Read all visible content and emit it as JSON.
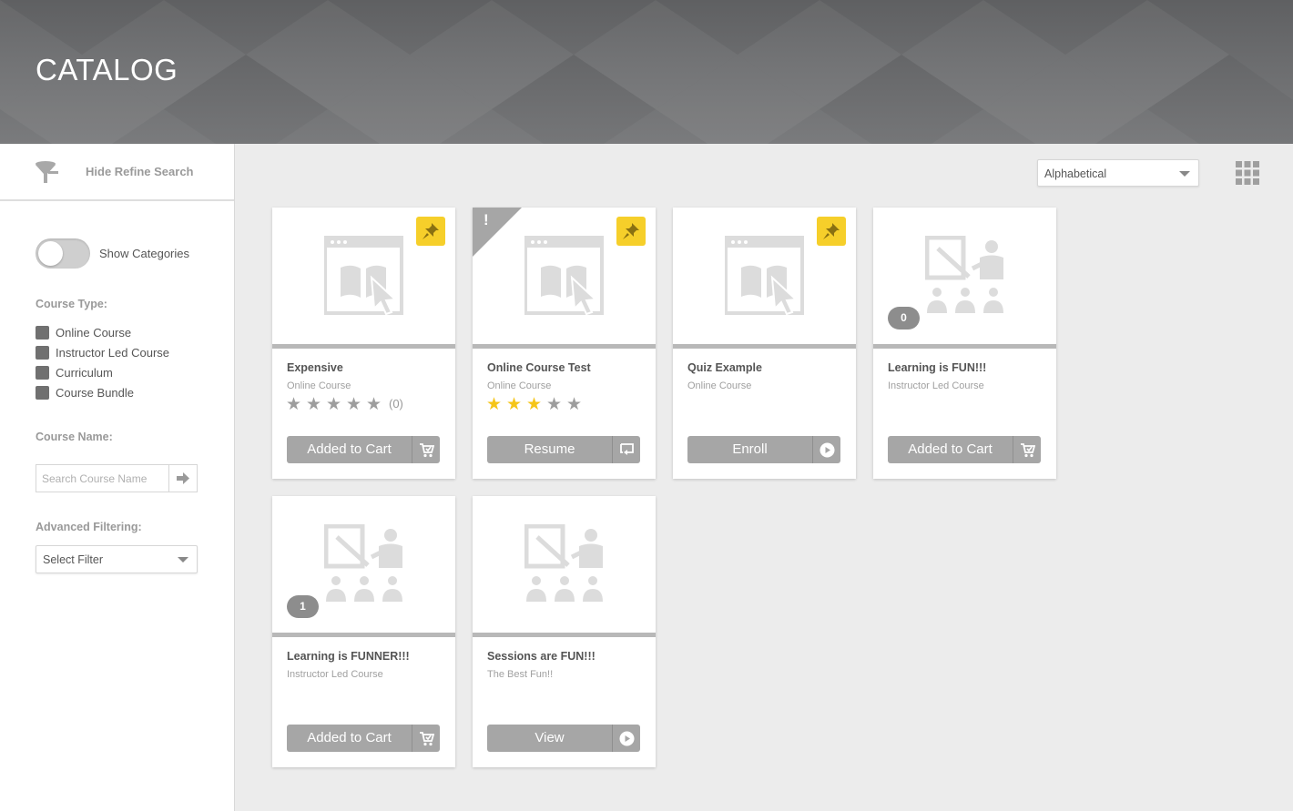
{
  "header": {
    "title": "CATALOG"
  },
  "sidebar": {
    "refine_label": "Hide Refine Search",
    "toggle_label": "Show Categories",
    "toggle_on": false,
    "course_type_label": "Course Type:",
    "course_types": [
      "Online Course",
      "Instructor Led Course",
      "Curriculum",
      "Course Bundle"
    ],
    "course_name_label": "Course Name:",
    "search_placeholder": "Search Course Name",
    "advanced_label": "Advanced Filtering:",
    "filter_value": "Select Filter"
  },
  "toolbar": {
    "sort_value": "Alphabetical"
  },
  "colors": {
    "pin": "#f6cf2a",
    "star_on": "#f5c518",
    "button": "#a6a6a6",
    "header": "#6c6d6f"
  },
  "cards": [
    {
      "title": "Expensive",
      "type": "Online Course",
      "pinned": true,
      "rating": 0,
      "rating_count": "(0)",
      "button": "Added to Cart",
      "button_icon": "cart-icon"
    },
    {
      "title": "Online Course Test",
      "type": "Online Course",
      "pinned": true,
      "flag": "!",
      "rating": 3,
      "button": "Resume",
      "button_icon": "resume-icon"
    },
    {
      "title": "Quiz Example",
      "type": "Online Course",
      "pinned": true,
      "button": "Enroll",
      "button_icon": "play-icon"
    },
    {
      "title": "Learning is FUN!!!",
      "type": "Instructor Led Course",
      "count": "0",
      "button": "Added to Cart",
      "button_icon": "cart-icon"
    },
    {
      "title": "Learning is FUNNER!!!",
      "type": "Instructor Led Course",
      "count": "1",
      "button": "Added to Cart",
      "button_icon": "cart-icon"
    },
    {
      "title": "Sessions are FUN!!!",
      "type": "The Best Fun!!",
      "button": "View",
      "button_icon": "play-icon"
    }
  ]
}
